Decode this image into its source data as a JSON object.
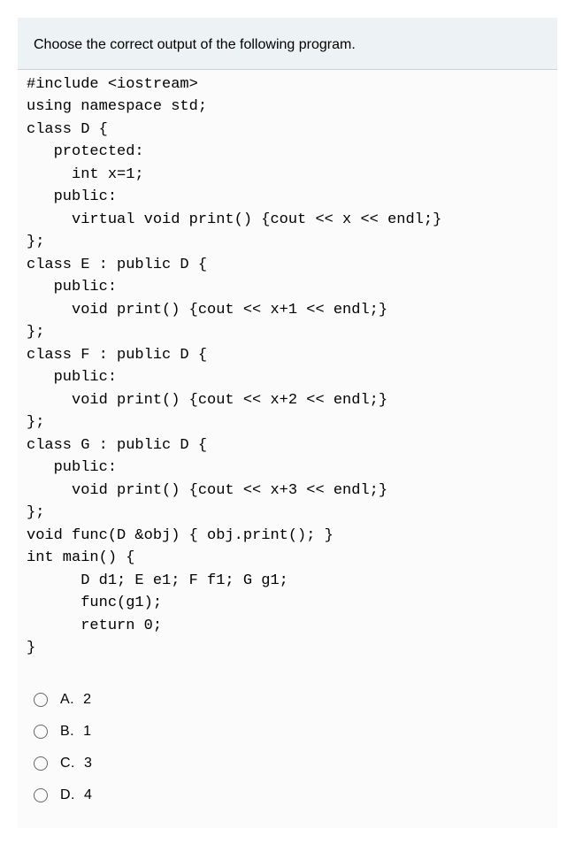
{
  "question": {
    "prompt": "Choose the correct output of the following program.",
    "code": "#include <iostream>\nusing namespace std;\nclass D {\n   protected:\n     int x=1;\n   public:\n     virtual void print() {cout << x << endl;}\n};\nclass E : public D {\n   public:\n     void print() {cout << x+1 << endl;}\n};\nclass F : public D {\n   public:\n     void print() {cout << x+2 << endl;}\n};\nclass G : public D {\n   public:\n     void print() {cout << x+3 << endl;}\n};\nvoid func(D &obj) { obj.print(); }\nint main() {\n      D d1; E e1; F f1; G g1;\n      func(g1);\n      return 0;\n}"
  },
  "options": [
    {
      "label": "A.",
      "value": "2"
    },
    {
      "label": "B.",
      "value": "1"
    },
    {
      "label": "C.",
      "value": "3"
    },
    {
      "label": "D.",
      "value": "4"
    }
  ]
}
